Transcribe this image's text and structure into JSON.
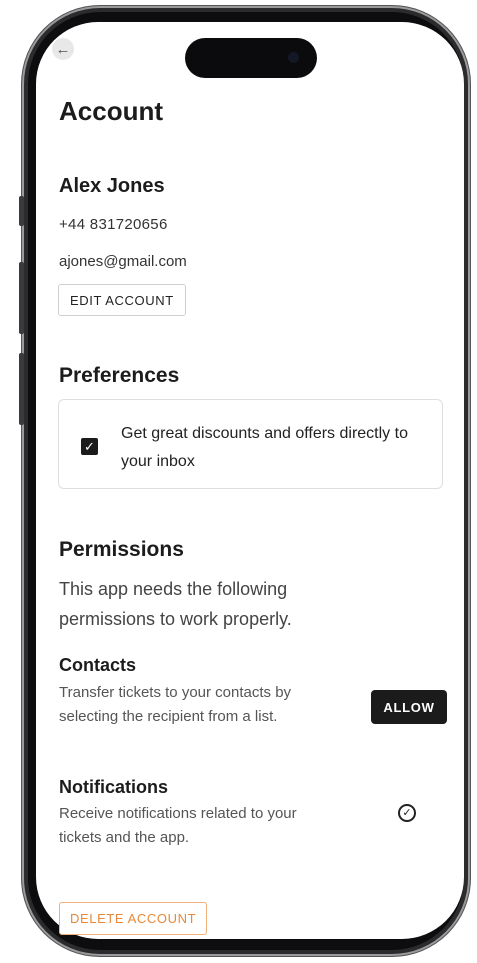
{
  "page": {
    "title": "Account"
  },
  "profile": {
    "name": "Alex Jones",
    "phone": "+44 831720656",
    "email": "ajones@gmail.com",
    "edit_label": "EDIT ACCOUNT"
  },
  "preferences": {
    "heading": "Preferences",
    "offers_label": "Get great discounts and offers directly to your inbox",
    "offers_checked": true
  },
  "permissions": {
    "heading": "Permissions",
    "description": "This app needs the following permissions to work properly.",
    "contacts": {
      "title": "Contacts",
      "description": "Transfer tickets to your contacts by selecting the recipient from a list.",
      "action_label": "ALLOW"
    },
    "notifications": {
      "title": "Notifications",
      "description": "Receive notifications related to your tickets and the app.",
      "status_icon": "check-circle-icon"
    }
  },
  "danger": {
    "delete_label": "DELETE ACCOUNT"
  },
  "icons": {
    "back": "arrow-left-icon",
    "checkbox": "checkmark-icon"
  },
  "colors": {
    "accent_danger": "#e8893a",
    "primary_button": "#1b1b1b"
  }
}
